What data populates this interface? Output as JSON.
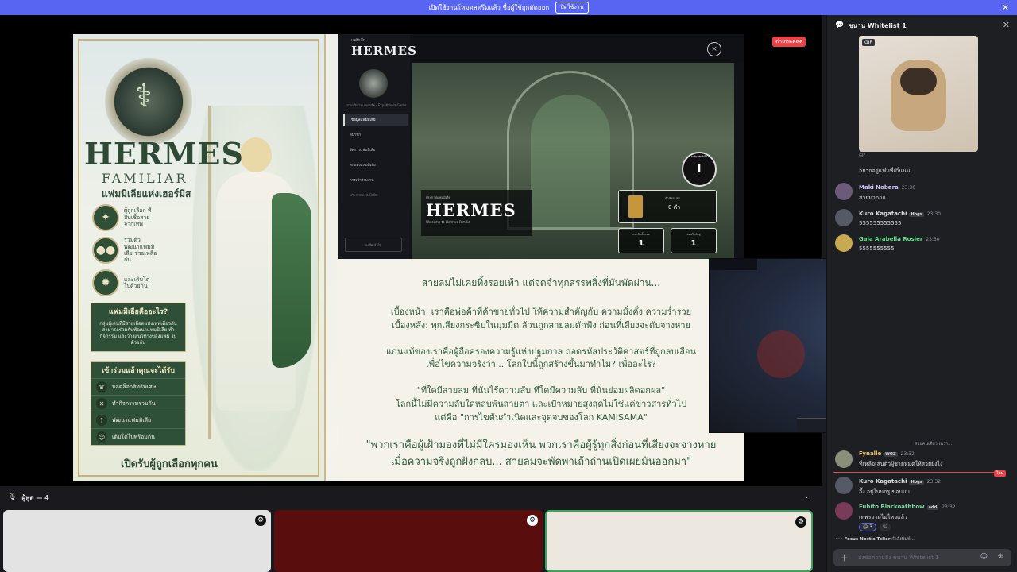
{
  "banner": {
    "text": "เปิดใช้งานโหมดสตรีมแล้ว ชื่อผู้ใช้ถูกตัดออก",
    "button": "ปิดใช้งาน",
    "close_icon": "close-icon"
  },
  "stage": {
    "live_badge": "ถ่ายทอดสด"
  },
  "poster": {
    "title": "HERMES",
    "subtitle": "FAMILIAR",
    "subtitle_th": "แฟมมิเลียแห่งเฮอร์มีส",
    "features": [
      {
        "icon": "✦",
        "text": "ผู้ถูกเลือก ที่สืบเชื้อสาย จากเทพ"
      },
      {
        "icon": "●●",
        "text": "รวมตัว พัฒนาแฟมมิเลีย ช่วยเหลือกัน"
      },
      {
        "icon": "✹",
        "text": "และเติบโต ไปด้วยกัน"
      }
    ],
    "panel1_title": "แฟมมิเลียคืออะไร?",
    "panel1_body": "กลุ่มผู้เล่นที่มีสายเลือดแห่งเทพเดียวกัน สามารถร่วมกันพัฒนาแฟมมิเลีย ทำกิจกรรม และวางแนวทางของแฟม ไปด้วยกัน",
    "panel2_title": "เข้าร่วมแล้วคุณจะได้รับ",
    "benefits": [
      "ปลดล็อกสิทธิพิเศษ",
      "ทำกิจกรรมร่วมกัน",
      "พัฒนาแฟมมิเลีย",
      "เติบโตไปพร้อมกัน"
    ],
    "bottom": "เปิดรับผู้ถูกเลือกทุกคน"
  },
  "gameui": {
    "small_top": "แฟมิเลีย",
    "logo": "HERMES",
    "close": "×",
    "crest_label": "ฝ่ายบริหารแฟมมิเลีย · Expathonia Game",
    "menu": [
      "ข้อมูลแฟมมิเลีย",
      "สมาชิก",
      "จัดการแฟมมิเลีย",
      "ตกแต่งแฟมมิเลีย",
      "การเข้าร่วมงาน",
      "ประกาศแฟมมิเลีย"
    ],
    "login": "ลงชื่อเข้าใช้",
    "main_small": "ประกาศแฟมมิเลีย",
    "main_big": "HERMES",
    "main_welcome": "Welcome to Hermes Familia",
    "level_label": "ระดับแฟมมิเลีย",
    "level": "I",
    "coin_label": "กำลังสะสม",
    "coin_value": "0 ดำ",
    "stat1_label": "สมาชิกทั้งหมด",
    "stat1_value": "1",
    "stat2_label": "ออนไลน์อยู่",
    "stat2_value": "1"
  },
  "story": {
    "l1": "สายลมไม่เคยทิ้งรอยเท้า แต่จดจำทุกสรรพสิ่งที่มันพัดผ่าน...",
    "l2": "เบื้องหน้า: เราคือพ่อค้าที่ค้าขายทั่วไป ให้ความสำคัญกับ ความมั่งคั่ง ความร่ำรวย",
    "l3": "เบื้องหลัง: ทุกเสียงกระซิบในมุมมืด ล้วนถูกสายลมดักฟัง ก่อนที่เสียงจะดับจางหาย",
    "l4": "แก่นแท้ของเราคือผู้ถือครองความรู้แห่งปฐมกาล ถอดรหัสประวัติศาสตร์ที่ถูกลบเลือน",
    "l5": "เพื่อไขความจริงว่า... โลกใบนี้ถูกสร้างขึ้นมาทำไม? เพื่ออะไร?",
    "l6": "\"ที่ใดมีสายลม ที่นั่นไร้ความลับ ที่ใดมีความลับ ที่นั่นย่อมผลิดอกผล\"",
    "l7": "โลกนี้ไม่มีความลับใดหลบพ้นสายตา และเป้าหมายสูงสุดไม่ใช่แค่ข่าวสารทั่วไป",
    "l8": "แต่คือ \"การไขต้นกำเนิดและจุดจบของโลก KAMISAMA\"",
    "q1": "\"พวกเราคือผู้เฝ้ามองที่ไม่มีใครมองเห็น พวกเราคือผู้รู้ทุกสิ่งก่อนที่เสียงจะจางหาย",
    "q2": "เมื่อความจริงถูกฝังกลบ... สายลมจะพัดพาเถ้าถ่านเปิดเผยมันออกมา\""
  },
  "speakers": {
    "label": "ผู้พูด — 4"
  },
  "chat": {
    "channel": "ชนาน Whitelist 1",
    "gif_badge": "GIF",
    "gif_caption": "GIF",
    "first_text": "อยากอยู่แฟมพี่เกิ่นนน",
    "messages": [
      {
        "name": "Maki Nobara",
        "time": "23:30",
        "text": "สวยมากกก",
        "color": "#d6c9ff"
      },
      {
        "name": "Kuro Kagatachi",
        "badge": "Hogs",
        "time": "23:30",
        "text": "555555555555",
        "color": "#dbdee1"
      },
      {
        "name": "Gaia Arabella Rosier",
        "time": "23:30",
        "text": "5555555555",
        "color": "#5de08a"
      }
    ],
    "reply_preview": "สวยคนเดียว เพรา...",
    "reply_user": "Fynalle",
    "reply_badge": "WOZ",
    "reply_time": "23:32",
    "reply_text": "ที่เหลือเล่นตัวผู้ชายหมดให้สวยยังไง",
    "new_label": "ใหม่",
    "msg2_name": "Kuro Kagatachi",
    "msg2_badge": "Hogs",
    "msg2_time": "23:32",
    "msg2_text": "อึ้ง อยู่ในนกรู ขอบบบ",
    "msg3_name": "Fubito Blackoathbow",
    "msg3_badge": "add",
    "msg3_time": "23:32",
    "msg3_text": "เทพรวามไม่ไหวแล้ว",
    "reaction_count": "3",
    "typing_user": "Focus Noctis Teller",
    "typing_text": "กำลังพิมพ์...",
    "input_placeholder": "ส่งข้อความถึง ชนาน Whitelist 1"
  }
}
